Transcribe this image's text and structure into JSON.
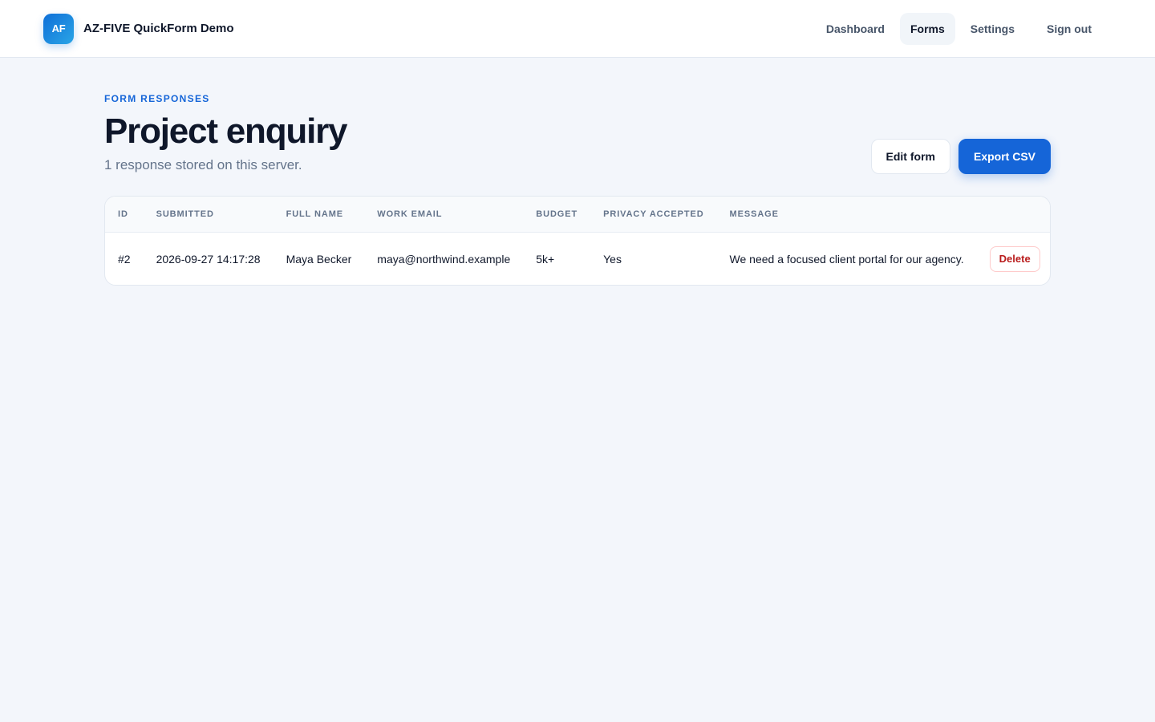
{
  "brand": {
    "logo_text": "AF",
    "name": "AZ-FIVE QuickForm Demo"
  },
  "nav": {
    "items": [
      {
        "label": "Dashboard",
        "active": false
      },
      {
        "label": "Forms",
        "active": true
      },
      {
        "label": "Settings",
        "active": false
      },
      {
        "label": "Sign out",
        "active": false
      }
    ]
  },
  "page": {
    "eyebrow": "FORM RESPONSES",
    "title": "Project enquiry",
    "subtitle": "1 response stored on this server."
  },
  "actions": {
    "edit_label": "Edit form",
    "export_label": "Export CSV"
  },
  "table": {
    "columns": [
      "ID",
      "SUBMITTED",
      "FULL NAME",
      "WORK EMAIL",
      "BUDGET",
      "PRIVACY ACCEPTED",
      "MESSAGE"
    ],
    "rows": [
      {
        "id": "#2",
        "submitted": "2026-09-27 14:17:28",
        "full_name": "Maya Becker",
        "work_email": "maya@northwind.example",
        "budget": "5k+",
        "privacy_accepted": "Yes",
        "message": "We need a focused client portal for our agency.",
        "delete_label": "Delete"
      }
    ]
  },
  "colors": {
    "accent": "#1565d8",
    "background": "#f3f6fb",
    "danger": "#b91c1c"
  }
}
